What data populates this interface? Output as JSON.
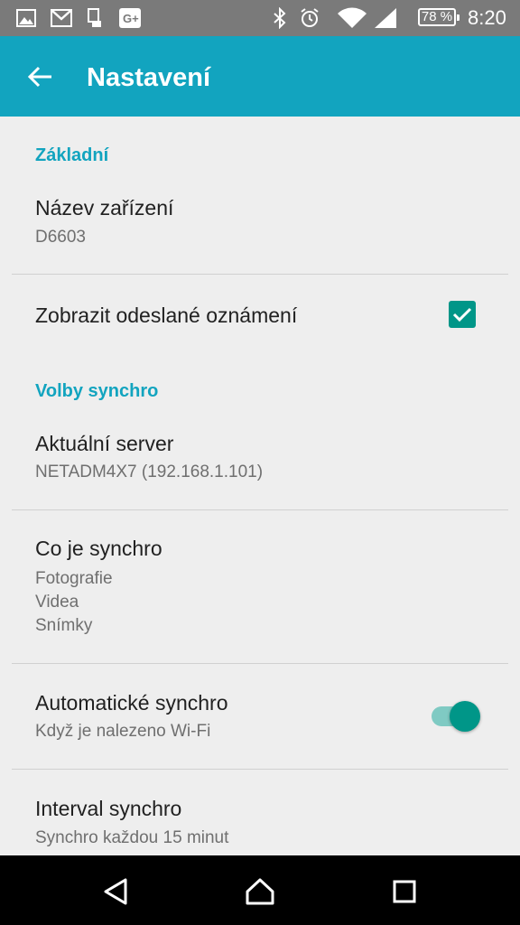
{
  "status_bar": {
    "battery": "78 %",
    "time": "8:20",
    "icons": [
      "image-icon",
      "gmail-icon",
      "device-icon",
      "google-plus-icon",
      "bluetooth-icon",
      "alarm-icon",
      "wifi-icon",
      "signal-icon"
    ]
  },
  "app_bar": {
    "title": "Nastavení"
  },
  "sections": {
    "basic": {
      "header": "Základní",
      "device_name": {
        "title": "Název zařízení",
        "value": "D6603"
      },
      "show_sent": {
        "title": "Zobrazit odeslané oznámení",
        "checked": true
      }
    },
    "sync": {
      "header": "Volby synchro",
      "server": {
        "title": "Aktuální server",
        "value": "NETADM4X7 (192.168.1.101)"
      },
      "what": {
        "title": "Co je synchro",
        "items": [
          "Fotografie",
          "Videa",
          "Snímky"
        ]
      },
      "auto": {
        "title": "Automatické synchro",
        "value": "Když je nalezeno Wi-Fi",
        "enabled": true
      },
      "interval": {
        "title": "Interval synchro",
        "value": "Synchro každou 15 minut"
      }
    }
  },
  "colors": {
    "accent": "#12a4bf",
    "control": "#009688",
    "background": "#eeeeee"
  }
}
